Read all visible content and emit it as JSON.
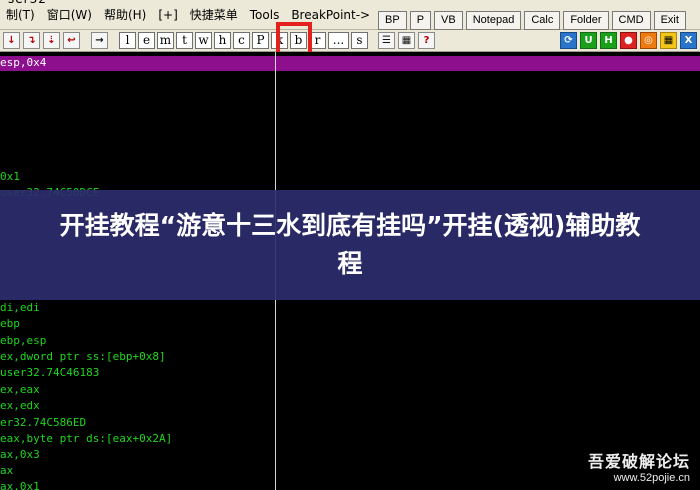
{
  "menubar": {
    "title_fragment": "ser32",
    "items": [
      "制(T)",
      "窗口(W)",
      "帮助(H)",
      "[+]",
      "快捷菜单",
      "Tools",
      "BreakPoint->"
    ],
    "window_buttons": [
      "BP",
      "P",
      "VB",
      "Notepad",
      "Calc",
      "Folder",
      "CMD",
      "Exit"
    ]
  },
  "toolbar": {
    "left_icons": [
      "step-into-icon",
      "step-over-icon",
      "trace-into-icon",
      "trace-over-icon",
      "execute-till-return-icon"
    ],
    "letter_buttons": [
      "l",
      "e",
      "m",
      "t",
      "w",
      "h",
      "c",
      "P",
      "k",
      "b",
      "r",
      "...",
      "s"
    ],
    "right_icons": [
      "list-icon",
      "patch-icon",
      "help-icon",
      "refresh-icon",
      "u-icon",
      "h-icon",
      "stop-icon",
      "target-icon",
      "grid-icon",
      "x-icon"
    ]
  },
  "code_lines": [
    {
      "text": "esp,0x4",
      "style": "purple"
    },
    {
      "text": "0x1",
      "style": "green"
    },
    {
      "text": "user32.74C50DCE",
      "style": "green"
    },
    {
      "text": "di,edi",
      "style": "green"
    },
    {
      "text": "ebp",
      "style": "green"
    },
    {
      "text": "ebp,esp",
      "style": "green"
    },
    {
      "text": "ex,dword ptr ss:[ebp+0x8]",
      "style": "green"
    },
    {
      "text": "user32.74C46183",
      "style": "green"
    },
    {
      "text": "ex,eax",
      "style": "green"
    },
    {
      "text": "ex,edx",
      "style": "green"
    },
    {
      "text": "er32.74C586ED",
      "style": "green"
    },
    {
      "text": "eax,byte ptr ds:[eax+0x2A]",
      "style": "green"
    },
    {
      "text": "ax,0x3",
      "style": "green"
    },
    {
      "text": "ax",
      "style": "green"
    },
    {
      "text": "ax,0x1",
      "style": "green"
    }
  ],
  "banner": {
    "title": "开挂教程“游意十三水到底有挂吗”开挂(透视)辅助教程"
  },
  "watermark": {
    "name": "吾爱破解论坛",
    "url": "www.52pojie.cn"
  }
}
